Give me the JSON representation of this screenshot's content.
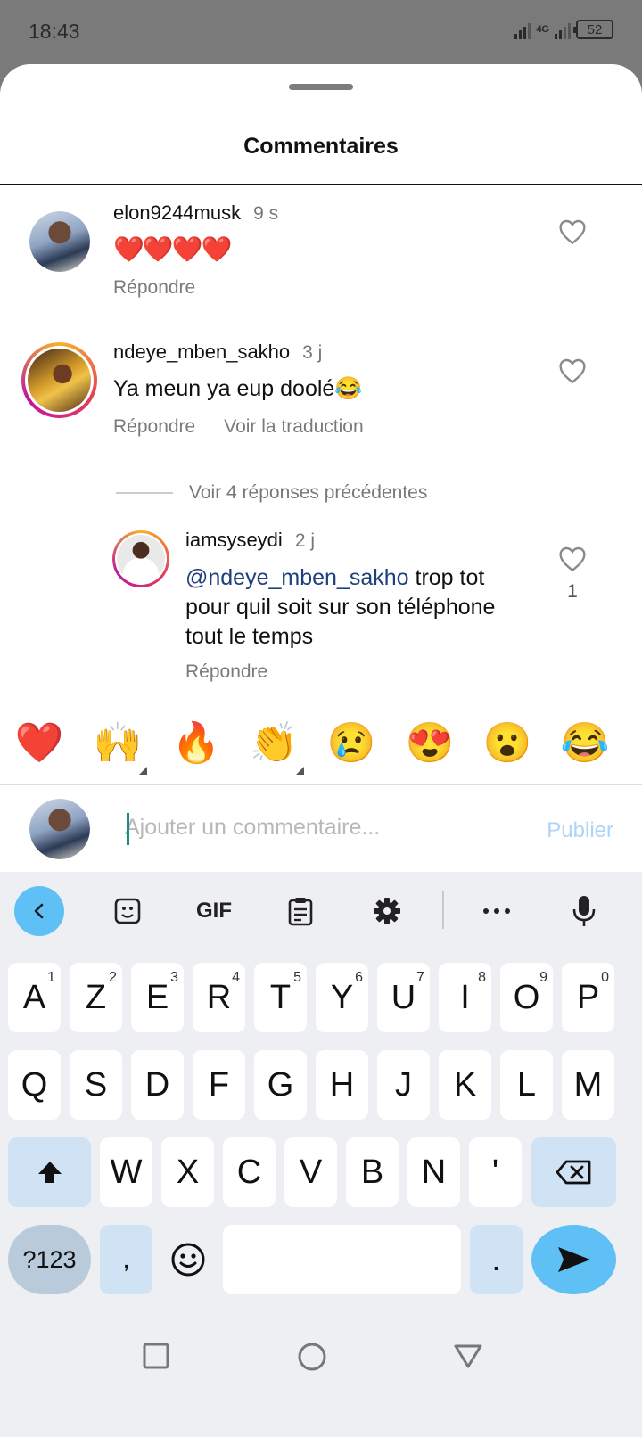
{
  "status": {
    "time": "18:43",
    "network": "4G",
    "battery": "52"
  },
  "sheet": {
    "title": "Commentaires"
  },
  "comments": [
    {
      "username": "elon9244musk",
      "time": "9 s",
      "text": "❤️❤️❤️❤️",
      "reply": "Répondre"
    },
    {
      "username": "ndeye_mben_sakho",
      "time": "3 j",
      "text": "Ya meun ya eup doolé😂",
      "reply": "Répondre",
      "translate": "Voir la traduction"
    }
  ],
  "previous_replies": "Voir 4 réponses précédentes",
  "reply": {
    "username": "iamsyseydi",
    "time": "2 j",
    "mention": "@ndeye_mben_sakho",
    "text_line1": " trop tot",
    "text_line2": "pour quil soit sur son téléphone",
    "text_line3": "tout le temps",
    "reply": "Répondre",
    "likes": "1"
  },
  "quick_emojis": [
    "❤️",
    "🙌",
    "🔥",
    "👏",
    "😢",
    "😍",
    "😮",
    "😂"
  ],
  "composer": {
    "placeholder": "Ajouter un commentaire...",
    "publish": "Publier"
  },
  "keyboard": {
    "toolbar_gif": "GIF",
    "row1": [
      [
        "A",
        "1"
      ],
      [
        "Z",
        "2"
      ],
      [
        "E",
        "3"
      ],
      [
        "R",
        "4"
      ],
      [
        "T",
        "5"
      ],
      [
        "Y",
        "6"
      ],
      [
        "U",
        "7"
      ],
      [
        "I",
        "8"
      ],
      [
        "O",
        "9"
      ],
      [
        "P",
        "0"
      ]
    ],
    "row2": [
      "Q",
      "S",
      "D",
      "F",
      "G",
      "H",
      "J",
      "K",
      "L",
      "M"
    ],
    "row3": [
      "W",
      "X",
      "C",
      "V",
      "B",
      "N",
      "'"
    ],
    "symbols": "?123",
    "comma": ",",
    "period": "."
  },
  "colors": {
    "accent": "#5ec0f5",
    "mention": "#1d3f7a",
    "publish_disabled": "#aed4f7"
  }
}
